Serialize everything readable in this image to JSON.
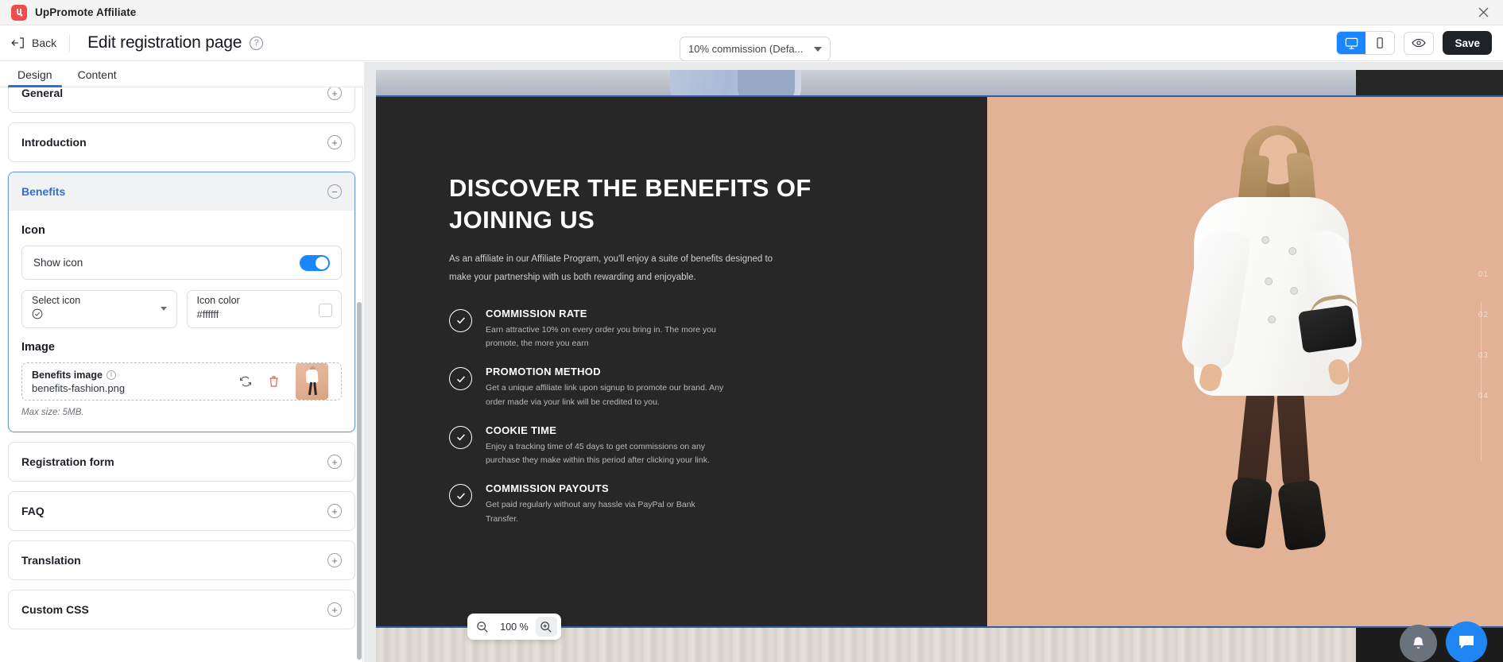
{
  "appbar": {
    "logo_icon": "uppromote-logo-icon",
    "title": "UpPromote Affiliate",
    "close_icon": "close-icon"
  },
  "header": {
    "back_label": "Back",
    "back_icon": "back-arrow-icon",
    "page_title": "Edit registration page",
    "help_icon": "help-circle-icon",
    "commission_value": "10% commission (Defa...",
    "desktop_icon": "desktop-icon",
    "mobile_icon": "mobile-icon",
    "preview_icon": "eye-icon",
    "save_label": "Save"
  },
  "tabs": [
    {
      "label": "Design",
      "active": true
    },
    {
      "label": "Content",
      "active": false
    }
  ],
  "sidebar": {
    "panels": [
      {
        "title": "General",
        "open": false,
        "toggle_icon": "plus-circle-icon"
      },
      {
        "title": "Introduction",
        "open": false,
        "toggle_icon": "plus-circle-icon"
      },
      {
        "title": "Benefits",
        "open": true,
        "toggle_icon": "minus-circle-icon"
      },
      {
        "title": "Registration form",
        "open": false,
        "toggle_icon": "plus-circle-icon"
      },
      {
        "title": "FAQ",
        "open": false,
        "toggle_icon": "plus-circle-icon"
      },
      {
        "title": "Translation",
        "open": false,
        "toggle_icon": "plus-circle-icon"
      },
      {
        "title": "Custom CSS",
        "open": false,
        "toggle_icon": "plus-circle-icon"
      }
    ],
    "benefits_panel": {
      "icon_section_label": "Icon",
      "show_icon_label": "Show icon",
      "show_icon_on": true,
      "select_icon_label": "Select icon",
      "select_icon_value_icon": "check-circle-icon",
      "icon_color_label": "Icon color",
      "icon_color_value": "#ffffff",
      "image_section_label": "Image",
      "benefits_image_label": "Benefits image",
      "benefits_image_info_icon": "info-icon",
      "benefits_image_filename": "benefits-fashion.png",
      "replace_icon": "replace-icon",
      "delete_icon": "trash-icon",
      "max_size_note": "Max size: 5MB."
    }
  },
  "preview": {
    "hero_title": "DISCOVER THE BENEFITS OF JOINING US",
    "hero_subtitle": "As an affiliate in our Affiliate Program, you'll enjoy a suite of benefits designed to make your partnership with us both rewarding and enjoyable.",
    "benefits": [
      {
        "icon": "check-circle-icon",
        "title": "COMMISSION RATE",
        "desc": "Earn attractive 10% on every order you bring in. The more you promote, the more you earn"
      },
      {
        "icon": "check-circle-icon",
        "title": "PROMOTION METHOD",
        "desc": "Get a unique affiliate link upon signup to promote our brand. Any order made via your link will be credited to you."
      },
      {
        "icon": "check-circle-icon",
        "title": "COOKIE TIME",
        "desc": "Enjoy a tracking time of 45 days to get commissions on any purchase they make within this period after clicking your link."
      },
      {
        "icon": "check-circle-icon",
        "title": "COMMISSION PAYOUTS",
        "desc": "Get paid regularly without any hassle via PayPal or Bank Transfer."
      }
    ],
    "slide_numbers": [
      "01",
      "02",
      "03",
      "04"
    ],
    "model_image_alt": "fashion-model-photo"
  },
  "zoom_control": {
    "zoom_out_icon": "zoom-out-icon",
    "value": "100 %",
    "zoom_in_icon": "zoom-in-icon"
  },
  "fabs": {
    "bell_icon": "bell-icon",
    "chat_icon": "chat-icon"
  },
  "colors": {
    "accent_blue": "#1a86ff",
    "panel_active_blue": "#2f6fd0",
    "save_dark": "#1f2328",
    "brand_red": "#ef4d4d",
    "preview_dark": "#272727",
    "preview_peach": "#e2b296"
  }
}
